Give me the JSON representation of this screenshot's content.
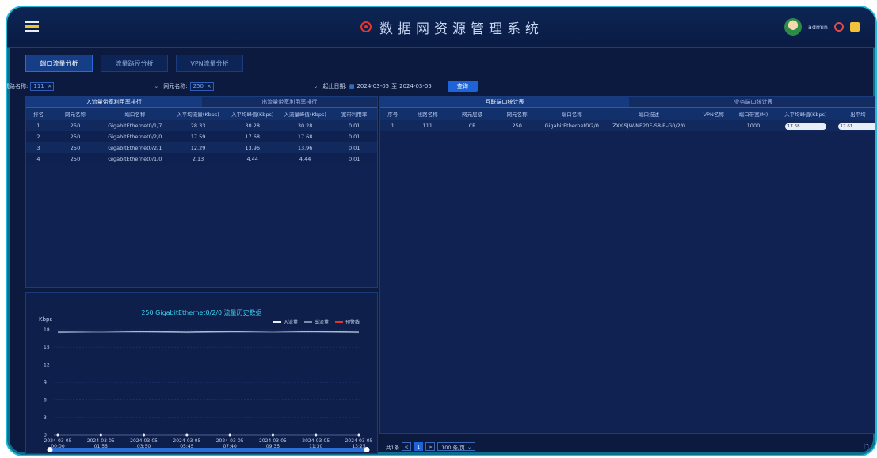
{
  "header": {
    "title": "数据网资源管理系统",
    "user": "admin"
  },
  "tabs": [
    "端口流量分析",
    "流量路径分析",
    "VPN流量分析"
  ],
  "filters": {
    "line_label": "线路名称:",
    "line_value": "111",
    "ne_label": "网元名称:",
    "ne_value": "250",
    "date_label": "起止日期:",
    "date_start": "2024-03-05",
    "date_sep": "至",
    "date_end": "2024-03-05",
    "query_label": "查询"
  },
  "left_panel": {
    "tabs": [
      "入流量带宽利用率排行",
      "出流量带宽利用率排行"
    ],
    "columns": [
      "排名",
      "网元名称",
      "端口名称",
      "入平均流量(Kbps)",
      "入平均峰值(Kbps)",
      "入流量峰值(Kbps)",
      "宽带利用率"
    ],
    "rows": [
      [
        "1",
        "250",
        "GigabitEthernet0/1/7",
        "28.33",
        "30.28",
        "30.28",
        "0.01"
      ],
      [
        "2",
        "250",
        "GigabitEthernet0/2/0",
        "17.59",
        "17.68",
        "17.68",
        "0.01"
      ],
      [
        "3",
        "250",
        "GigabitEthernet0/2/1",
        "12.29",
        "13.96",
        "13.96",
        "0.01"
      ],
      [
        "4",
        "250",
        "GigabitEthernet0/1/0",
        "2.13",
        "4.44",
        "4.44",
        "0.01"
      ]
    ]
  },
  "right_panel": {
    "tabs": [
      "互联端口统计表",
      "业务端口统计表"
    ],
    "columns": [
      "序号",
      "线路名称",
      "网元层级",
      "网元名称",
      "端口名称",
      "端口描述",
      "VPN名称",
      "端口带宽(M)",
      "入平均峰值(Kbps)",
      "出平均"
    ],
    "rows": [
      [
        "1",
        "111",
        "CR",
        "250",
        "GigabitEthernet0/2/0",
        "ZXY-SJW-NE20E-S8-B-G0/2/0",
        "",
        "1000",
        "17.68",
        "17.61"
      ]
    ],
    "pager": {
      "total": "共1条",
      "prev": "<",
      "page": "1",
      "next": ">",
      "page_size": "100 条/页"
    }
  },
  "chart": {
    "title": "250 GigabitEthernet0/2/0 流量历史数据",
    "unit": "Kbps",
    "legend": [
      {
        "name": "入流量",
        "color": "#e7ecf5"
      },
      {
        "name": "出流量",
        "color": "#7b8cad"
      },
      {
        "name": "预警线",
        "color": "#e0342f"
      }
    ]
  },
  "chart_data": {
    "type": "line",
    "title": "250 GigabitEthernet0/2/0 流量历史数据",
    "ylabel": "Kbps",
    "ylim": [
      0,
      18
    ],
    "yticks": [
      "0",
      "3",
      "6",
      "9",
      "12",
      "15",
      "18"
    ],
    "x": [
      "2024-03-05 00:00",
      "2024-03-05 01:55",
      "2024-03-05 03:50",
      "2024-03-05 05:45",
      "2024-03-05 07:40",
      "2024-03-05 09:35",
      "2024-03-05 11:30",
      "2024-03-05 13:25"
    ],
    "series": [
      {
        "name": "入流量",
        "values": [
          17.6,
          17.6,
          17.7,
          17.6,
          17.7,
          17.6,
          17.7,
          17.6
        ]
      },
      {
        "name": "出流量",
        "values": [
          17.5,
          17.6,
          17.6,
          17.5,
          17.6,
          17.6,
          17.6,
          17.5
        ]
      }
    ],
    "grid": true,
    "legend": "top-right"
  }
}
